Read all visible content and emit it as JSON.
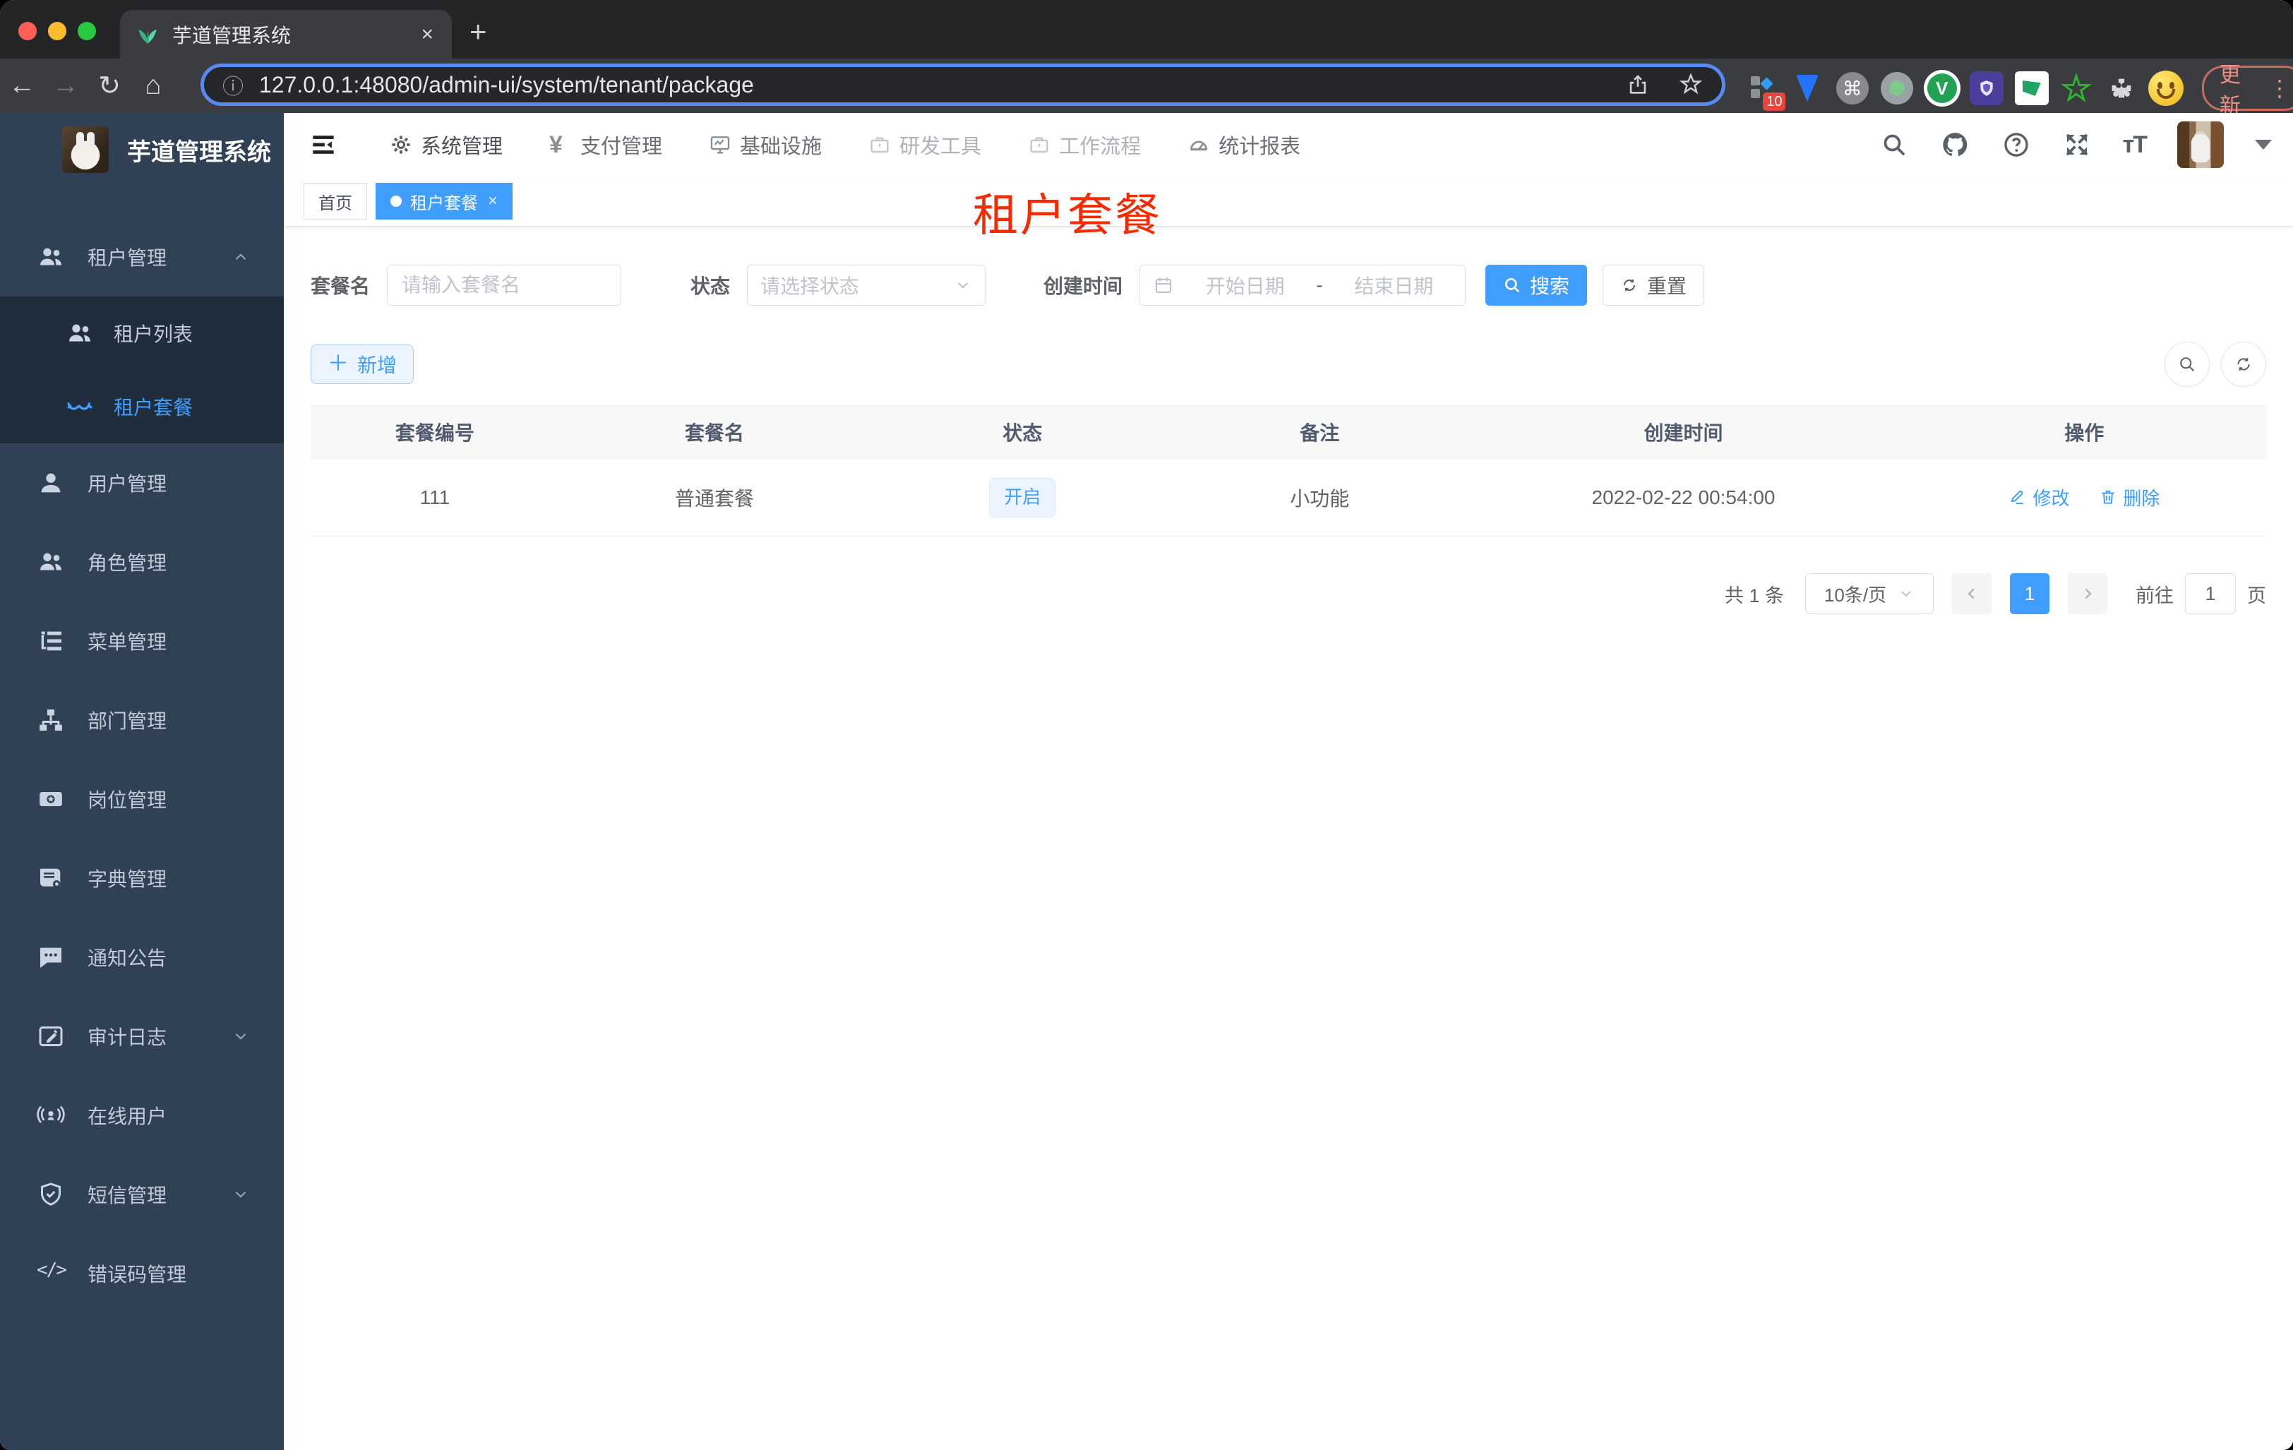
{
  "browser": {
    "tab_title": "芋道管理系统",
    "close_glyph": "×",
    "new_tab_glyph": "+",
    "url": "127.0.0.1:48080/admin-ui/system/tenant/package",
    "update_label": "更新",
    "extension_badge": "10"
  },
  "topnav": {
    "items": [
      "系统管理",
      "支付管理",
      "基础设施",
      "研发工具",
      "工作流程",
      "统计报表"
    ]
  },
  "sidebar": {
    "title": "芋道管理系统",
    "items": [
      {
        "label": "租户管理"
      },
      {
        "label": "租户列表"
      },
      {
        "label": "租户套餐"
      },
      {
        "label": "用户管理"
      },
      {
        "label": "角色管理"
      },
      {
        "label": "菜单管理"
      },
      {
        "label": "部门管理"
      },
      {
        "label": "岗位管理"
      },
      {
        "label": "字典管理"
      },
      {
        "label": "通知公告"
      },
      {
        "label": "审计日志"
      },
      {
        "label": "在线用户"
      },
      {
        "label": "短信管理"
      },
      {
        "label": "错误码管理"
      }
    ]
  },
  "tags": {
    "home": "首页",
    "active": "租户套餐"
  },
  "overlay_title": "租户套餐",
  "filters": {
    "name_label": "套餐名",
    "name_placeholder": "请输入套餐名",
    "status_label": "状态",
    "status_placeholder": "请选择状态",
    "date_label": "创建时间",
    "date_start": "开始日期",
    "date_separator": "-",
    "date_end": "结束日期",
    "search_label": "搜索",
    "reset_label": "重置"
  },
  "toolbar": {
    "add_label": "新增"
  },
  "table": {
    "columns": [
      "套餐编号",
      "套餐名",
      "状态",
      "备注",
      "创建时间",
      "操作"
    ],
    "rows": [
      {
        "id": "111",
        "name": "普通套餐",
        "status": "开启",
        "remark": "小功能",
        "created_at": "2022-02-22 00:54:00",
        "edit_label": "修改",
        "delete_label": "删除"
      }
    ]
  },
  "pagination": {
    "total": "共 1 条",
    "page_size": "10条/页",
    "page": "1",
    "goto_label": "前往",
    "goto_value": "1",
    "page_unit": "页"
  },
  "colors": {
    "accent": "#409eff",
    "overlay_red": "#f42a00"
  }
}
